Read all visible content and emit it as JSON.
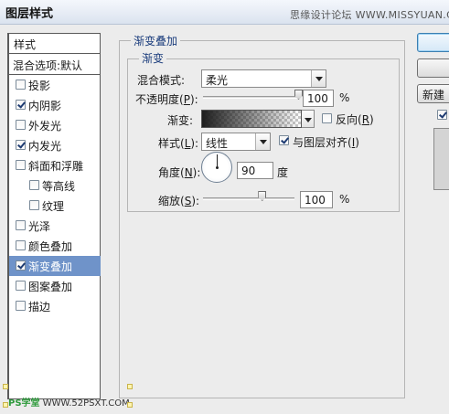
{
  "window": {
    "title": "图层样式",
    "watermark": "思缘设计论坛 WWW.MISSYUAN.COM"
  },
  "left_panel": {
    "header": "样式",
    "blend_options": "混合选项:默认",
    "items": [
      {
        "label": "投影",
        "checked": false,
        "selected": false,
        "indent": false
      },
      {
        "label": "内阴影",
        "checked": true,
        "selected": false,
        "indent": false
      },
      {
        "label": "外发光",
        "checked": false,
        "selected": false,
        "indent": false
      },
      {
        "label": "内发光",
        "checked": true,
        "selected": false,
        "indent": false
      },
      {
        "label": "斜面和浮雕",
        "checked": false,
        "selected": false,
        "indent": false
      },
      {
        "label": "等高线",
        "checked": false,
        "selected": false,
        "indent": true
      },
      {
        "label": "纹理",
        "checked": false,
        "selected": false,
        "indent": true
      },
      {
        "label": "光泽",
        "checked": false,
        "selected": false,
        "indent": false
      },
      {
        "label": "颜色叠加",
        "checked": false,
        "selected": false,
        "indent": false
      },
      {
        "label": "渐变叠加",
        "checked": true,
        "selected": true,
        "indent": false
      },
      {
        "label": "图案叠加",
        "checked": false,
        "selected": false,
        "indent": false
      },
      {
        "label": "描边",
        "checked": false,
        "selected": false,
        "indent": false
      }
    ],
    "watermark": {
      "a": "PS学堂",
      "b": "WWW.52PSXT.COM"
    }
  },
  "gradient_overlay": {
    "section_title": "渐变叠加",
    "group_title": "渐变",
    "blend_mode": {
      "label": "混合模式:",
      "value": "柔光"
    },
    "opacity": {
      "label_pre": "不透明度(",
      "key": "P",
      "label_post": "):",
      "value": "100",
      "unit": "%"
    },
    "gradient": {
      "label": "渐变:",
      "colors": [
        "#1e1e1e",
        "transparent"
      ]
    },
    "reverse": {
      "label_pre": "反向(",
      "key": "R",
      "label_post": ")",
      "checked": false
    },
    "style": {
      "label_pre": "样式(",
      "key": "L",
      "label_post": "):",
      "value": "线性"
    },
    "align": {
      "label_pre": "与图层对齐(",
      "key": "I",
      "label_post": ")",
      "checked": true
    },
    "angle": {
      "label_pre": "角度(",
      "key": "N",
      "label_post": "):",
      "value": "90",
      "unit": "度",
      "degrees": 90
    },
    "scale": {
      "label_pre": "缩放(",
      "key": "S",
      "label_post": "):",
      "value": "100",
      "unit": "%"
    }
  },
  "buttons": {
    "ok": "",
    "cancel": "",
    "new_style": "新建",
    "preview_checked": true
  }
}
